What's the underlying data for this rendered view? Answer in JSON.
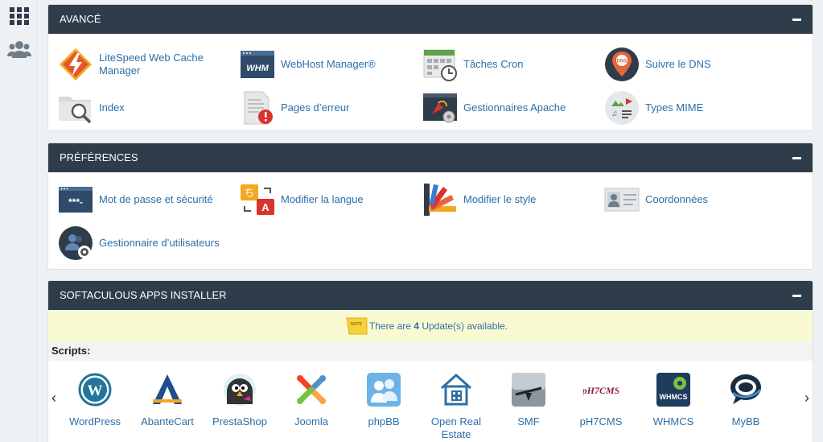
{
  "sidebar": {
    "items": [
      {
        "icon": "grid-icon"
      },
      {
        "icon": "users-icon"
      }
    ]
  },
  "panels": {
    "advanced": {
      "title": "Avancé",
      "items": [
        {
          "label": "LiteSpeed Web Cache Manager",
          "icon": "litespeed-icon"
        },
        {
          "label": "WebHost Manager®",
          "icon": "whm-icon"
        },
        {
          "label": "Tâches Cron",
          "icon": "calendar-clock-icon"
        },
        {
          "label": "Suivre le DNS",
          "icon": "dns-pin-icon"
        },
        {
          "label": "Index",
          "icon": "folder-search-icon"
        },
        {
          "label": "Pages d’erreur",
          "icon": "error-page-icon"
        },
        {
          "label": "Gestionnaires Apache",
          "icon": "apache-handler-icon"
        },
        {
          "label": "Types MIME",
          "icon": "mime-types-icon"
        }
      ]
    },
    "preferences": {
      "title": "Préférences",
      "items": [
        {
          "label": "Mot de passe et sécurité",
          "icon": "password-icon"
        },
        {
          "label": "Modifier la langue",
          "icon": "language-icon"
        },
        {
          "label": "Modifier le style",
          "icon": "style-palette-icon"
        },
        {
          "label": "Coordonnées",
          "icon": "contact-card-icon"
        },
        {
          "label": "Gestionnaire d’utilisateurs",
          "icon": "user-manager-icon"
        }
      ]
    },
    "softaculous": {
      "title": "Softaculous Apps Installer",
      "notice": {
        "prefix": "There are",
        "count": "4",
        "suffix": "Update(s) available."
      },
      "scripts_label": "Scripts:",
      "apps": [
        {
          "name": "WordPress",
          "icon": "wordpress-icon"
        },
        {
          "name": "AbanteCart",
          "icon": "abantecart-icon"
        },
        {
          "name": "PrestaShop",
          "icon": "prestashop-icon"
        },
        {
          "name": "Joomla",
          "icon": "joomla-icon"
        },
        {
          "name": "phpBB",
          "icon": "phpbb-icon"
        },
        {
          "name": "Open Real Estate",
          "icon": "house-icon"
        },
        {
          "name": "SMF",
          "icon": "smf-icon"
        },
        {
          "name": "pH7CMS",
          "icon": "ph7cms-icon"
        },
        {
          "name": "WHMCS",
          "icon": "whmcs-icon"
        },
        {
          "name": "MyBB",
          "icon": "mybb-icon"
        }
      ],
      "prev": "‹",
      "next": "›"
    }
  },
  "colors": {
    "header": "#2f3c4a",
    "link": "#2b6fa8",
    "notice_bg": "#fafad2"
  }
}
